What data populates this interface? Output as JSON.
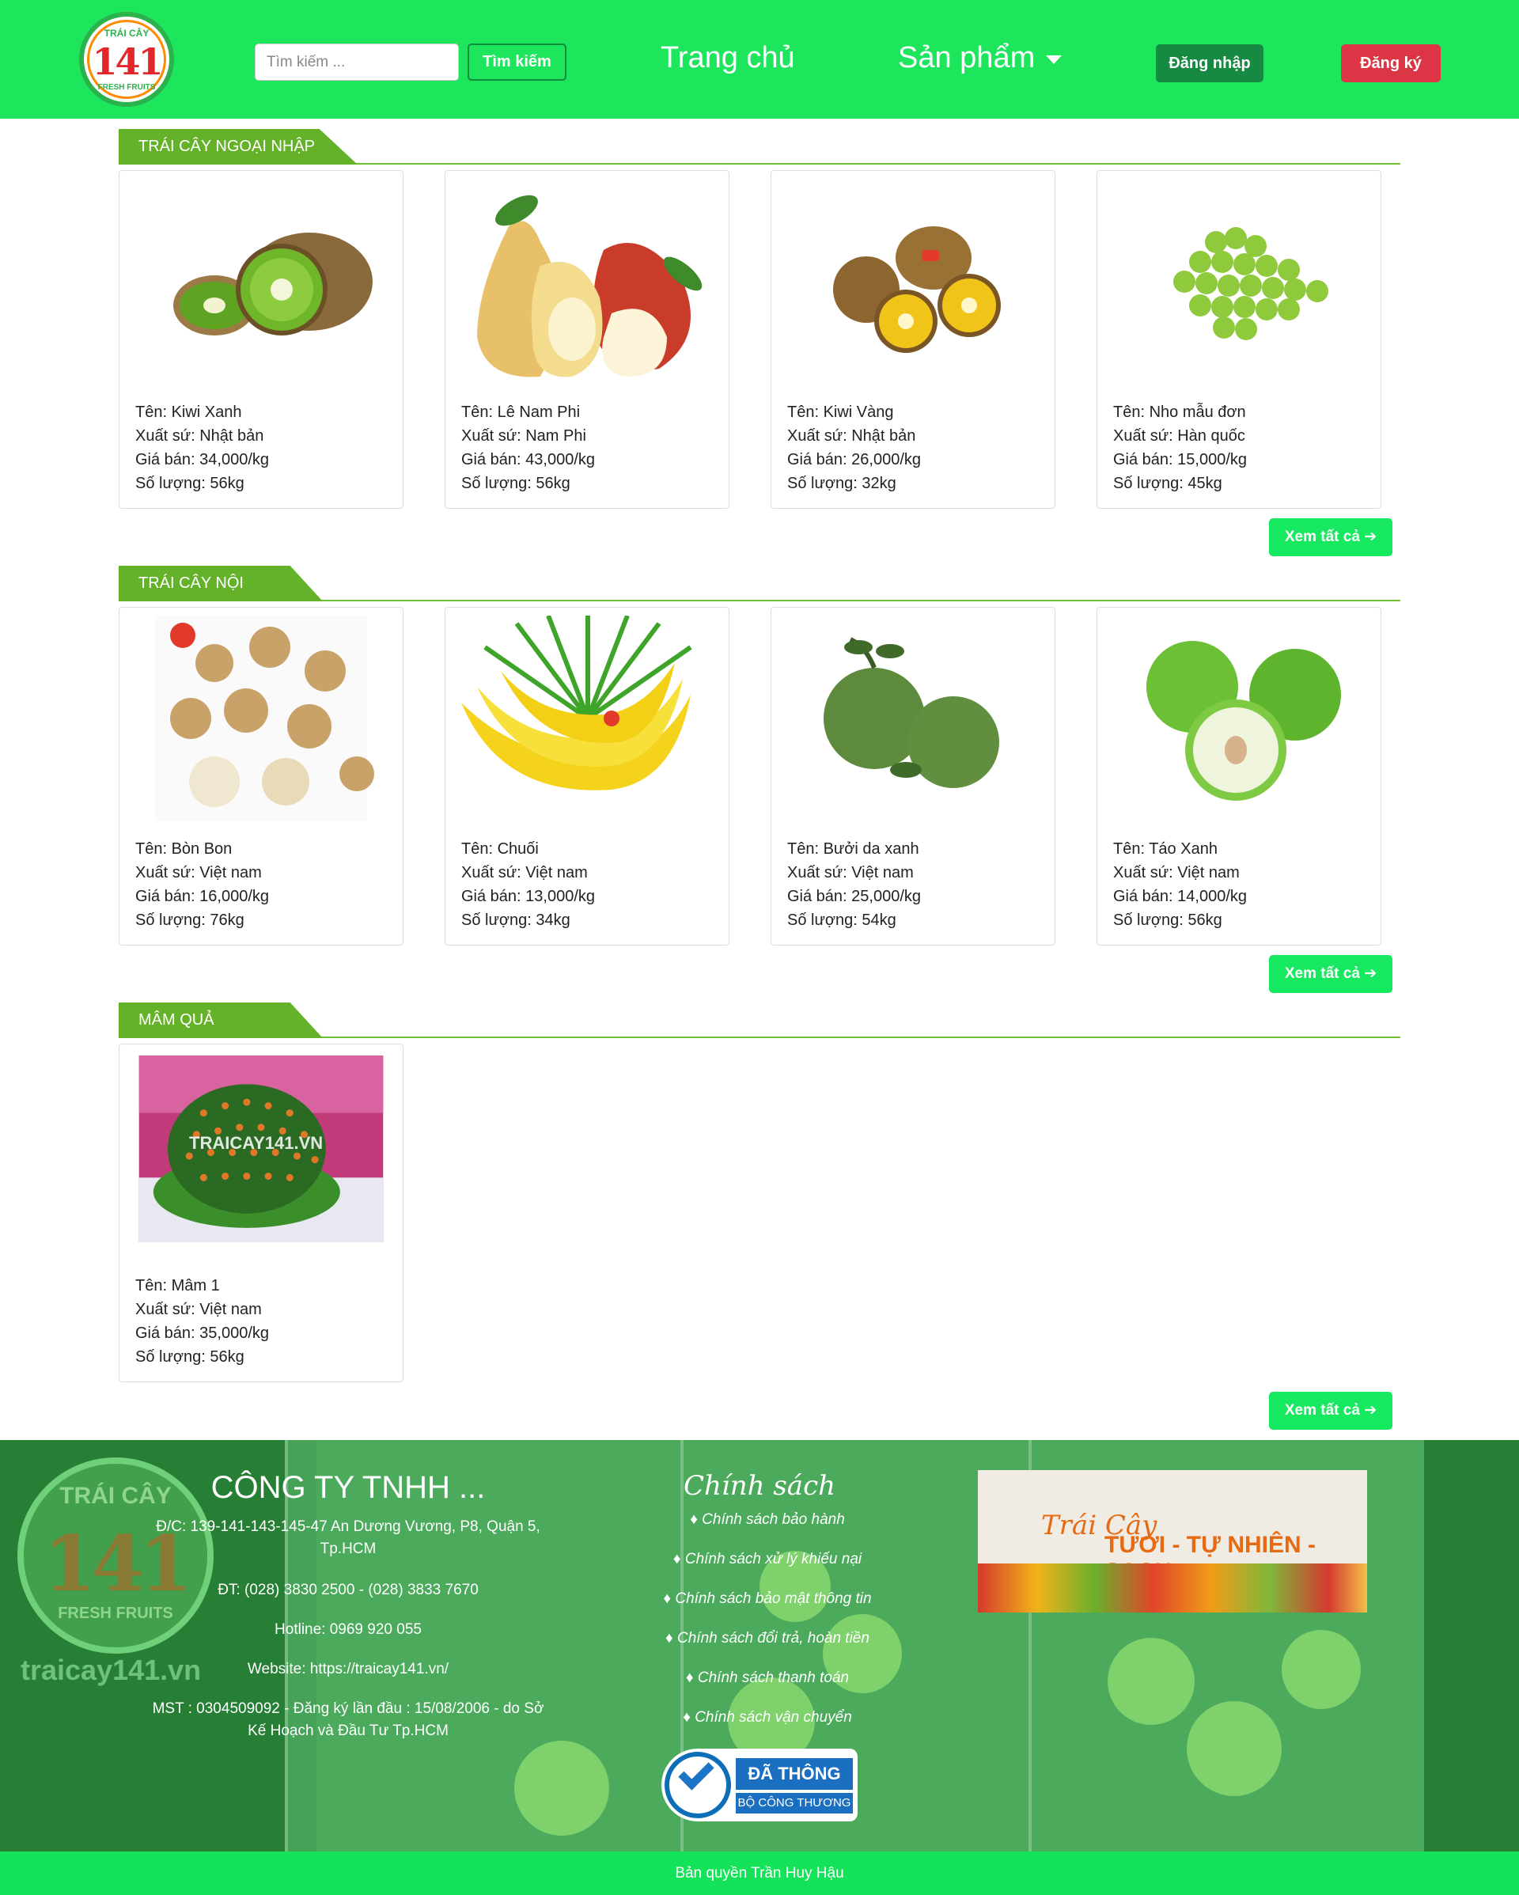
{
  "header": {
    "logo_top_text": "TRÁI CÂY",
    "logo_number": "141",
    "logo_bottom_text": "FRESH FRUITS",
    "search_placeholder": "Tìm kiếm ...",
    "search_button": "Tìm kiếm",
    "nav_home": "Trang chủ",
    "nav_products": "Sản phẩm",
    "login_button": "Đăng nhập",
    "register_button": "Đăng ký"
  },
  "sections": [
    {
      "title": "TRÁI CÂY NGOẠI NHẬP",
      "see_all": "Xem tất cả ➔",
      "products": [
        {
          "name": "Tên: Kiwi Xanh",
          "origin": "Xuất sứ: Nhật bản",
          "price": "Giá bán: 34,000/kg",
          "qty": "Số lượng: 56kg",
          "image": "kiwi-green"
        },
        {
          "name": "Tên: Lê Nam Phi",
          "origin": "Xuất sứ: Nam Phi",
          "price": "Giá bán: 43,000/kg",
          "qty": "Số lượng: 56kg",
          "image": "pear"
        },
        {
          "name": "Tên: Kiwi Vàng",
          "origin": "Xuất sứ: Nhật bản",
          "price": "Giá bán: 26,000/kg",
          "qty": "Số lượng: 32kg",
          "image": "kiwi-gold"
        },
        {
          "name": "Tên: Nho mẫu đơn",
          "origin": "Xuất sứ: Hàn quốc",
          "price": "Giá bán: 15,000/kg",
          "qty": "Số lượng: 45kg",
          "image": "grapes"
        }
      ]
    },
    {
      "title": "TRÁI CÂY NỘI",
      "see_all": "Xem tất cả ➔",
      "products": [
        {
          "name": "Tên: Bòn Bon",
          "origin": "Xuất sứ: Việt nam",
          "price": "Giá bán: 16,000/kg",
          "qty": "Số lượng: 76kg",
          "image": "longan"
        },
        {
          "name": "Tên: Chuối",
          "origin": "Xuất sứ: Việt nam",
          "price": "Giá bán: 13,000/kg",
          "qty": "Số lượng: 34kg",
          "image": "banana"
        },
        {
          "name": "Tên: Bưởi da xanh",
          "origin": "Xuất sứ: Việt nam",
          "price": "Giá bán: 25,000/kg",
          "qty": "Số lượng: 54kg",
          "image": "pomelo"
        },
        {
          "name": "Tên: Táo Xanh",
          "origin": "Xuất sứ: Việt nam",
          "price": "Giá bán: 14,000/kg",
          "qty": "Số lượng: 56kg",
          "image": "green-apple"
        }
      ]
    },
    {
      "title": "MÂM QUẢ",
      "see_all": "Xem tất cả ➔",
      "products": [
        {
          "name": "Tên: Mâm 1",
          "origin": "Xuất sứ: Việt nam",
          "price": "Giá bán: 35,000/kg",
          "qty": "Số lượng: 56kg",
          "image": "fruit-tray",
          "watermark": "TRAICAY141.VN"
        }
      ]
    }
  ],
  "footer": {
    "logo_top_text": "TRÁI CÂY",
    "logo_number": "141",
    "logo_bottom_text": "FRESH FRUITS",
    "site": "traicay141.vn",
    "company_title": "CÔNG TY TNHH ...",
    "address": "Đ/C: 139-141-143-145-47 An Dương Vương, P8, Quận 5, Tp.HCM",
    "phone": "ĐT: (028) 3830 2500 - (028) 3833 7670",
    "hotline": "Hotline: 0969 920 055",
    "website": "Website: https://traicay141.vn/",
    "tax": "MST : 0304509092 - Đăng ký lần đầu : 15/08/2006 - do Sở Kế Hoạch và Đầu Tư Tp.HCM",
    "policy_title": "Chính sách",
    "policies": [
      "♦ Chính sách bảo hành",
      "♦ Chính sách xử lý khiếu nại",
      "♦ Chính sách bảo mật thông tin",
      "♦ Chính sách đổi trả, hoàn tiền",
      "♦ Chính sách thanh toán",
      "♦ Chính sách vận chuyển"
    ],
    "badge_line1": "ĐÃ THÔNG BÁO",
    "badge_line2": "BỘ CÔNG THƯƠNG",
    "banner_line1": "Trái Cây",
    "banner_line2": "TƯƠI - TỰ NHIÊN - SẠCH"
  },
  "copyright": "Bản quyền Trần Huy Hậu",
  "colors": {
    "header_bg": "#1de55c",
    "section_tab": "#64b12a",
    "see_all_bg": "#16e85f",
    "login_bg": "#168a43",
    "register_bg": "#dc3545",
    "footer_bg": "#2f8b3d"
  }
}
